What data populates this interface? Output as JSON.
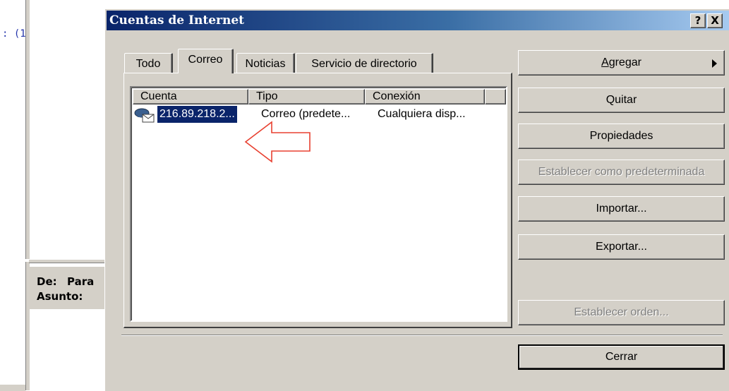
{
  "background": {
    "code_fragment": ": (1",
    "from_label": "De:",
    "to_label": "Para",
    "subject_label": "Asunto:"
  },
  "dialog": {
    "title": "Cuentas de Internet",
    "help_button": "?",
    "close_button": "X",
    "tabs": [
      {
        "label": "Todo",
        "active": false
      },
      {
        "label": "Correo",
        "active": true
      },
      {
        "label": "Noticias",
        "active": false
      },
      {
        "label": "Servicio de directorio",
        "active": false
      }
    ],
    "columns": [
      "Cuenta",
      "Tipo",
      "Conexión"
    ],
    "rows": [
      {
        "account": "216.89.218.2...",
        "type": "Correo (predete...",
        "connection": "Cualquiera disp...",
        "icon": "mail-account-icon",
        "selected": true
      }
    ],
    "buttons": {
      "add": "Agregar",
      "remove": "Quitar",
      "properties": "Propiedades",
      "set_default": "Establecer como predeterminada",
      "import": "Importar...",
      "export": "Exportar...",
      "set_order": "Establecer orden...",
      "close": "Cerrar"
    }
  },
  "annotation": {
    "type": "arrow",
    "color": "#e84030",
    "direction": "left"
  },
  "colors": {
    "title_gradient_start": "#0a246a",
    "title_gradient_end": "#a6caf0",
    "face": "#d4d0c8",
    "selection": "#0a246a"
  }
}
